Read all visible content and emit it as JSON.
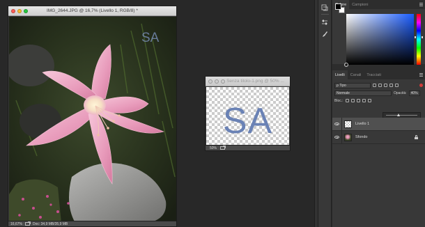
{
  "doc1": {
    "title": "IMG_2644.JPG @ 16,7% (Livello 1, RGB/8)",
    "title_suffix": "*",
    "watermark": "SA",
    "zoom": "16,67%",
    "doc_info": "Doc: 34,9 MB/35,9 MB"
  },
  "doc2": {
    "title": "Senza titolo-1.png @ 50% ...",
    "text": "SA",
    "zoom": "50%"
  },
  "color_panel": {
    "tabs": [
      "Colore",
      "Campioni"
    ],
    "foreground": "#000000",
    "background": "#ffffff",
    "hue_color": "#1a5cff"
  },
  "layers_panel": {
    "tabs": [
      "Livelli",
      "Canali",
      "Tracciati"
    ],
    "filter_label": "ρ Tipo",
    "blend_mode": "Normale",
    "opacity_label": "Opacità:",
    "opacity_value": "40%",
    "opacity_fraction": 0.4,
    "lock_label": "Bloc.:",
    "layers": [
      {
        "name": "Livello 1",
        "selected": true,
        "thumb": "transparent"
      },
      {
        "name": "Sfondo",
        "selected": false,
        "thumb": "photo"
      }
    ]
  },
  "colors": {
    "accent_text": "#6a82b5"
  }
}
